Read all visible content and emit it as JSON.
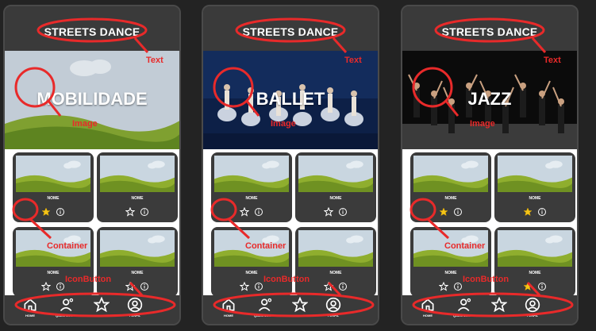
{
  "phones": [
    {
      "header_title": "STREETS DANCE",
      "hero_title": "MOBILIDADE",
      "cards": [
        {
          "name": "NOME",
          "favorited": true
        },
        {
          "name": "NOME",
          "favorited": false
        },
        {
          "name": "NOME",
          "favorited": false
        },
        {
          "name": "NOME",
          "favorited": false
        }
      ]
    },
    {
      "header_title": "STREETS DANCE",
      "hero_title": "BALLET",
      "cards": [
        {
          "name": "NOME",
          "favorited": false
        },
        {
          "name": "NOME",
          "favorited": false
        },
        {
          "name": "NOME",
          "favorited": false
        },
        {
          "name": "NOME",
          "favorited": false
        }
      ]
    },
    {
      "header_title": "STREETS DANCE",
      "hero_title": "JAZZ",
      "cards": [
        {
          "name": "NOME",
          "favorited": true
        },
        {
          "name": "NOME",
          "favorited": true
        },
        {
          "name": "NOME",
          "favorited": false
        },
        {
          "name": "NOME",
          "favorited": true
        }
      ]
    }
  ],
  "nav_items": [
    "HOME",
    "QUEM SOMOS",
    "FAVORITOS",
    "PERFIL"
  ],
  "annotations": {
    "text": "Text",
    "image": "Image",
    "container": "Container",
    "iconbutton": "IconButton"
  },
  "colors": {
    "annotation": "#e82a2a",
    "star_active": "#f5c518",
    "frame_bg": "#2f2f2f",
    "header_bg": "#3a3a3a"
  }
}
